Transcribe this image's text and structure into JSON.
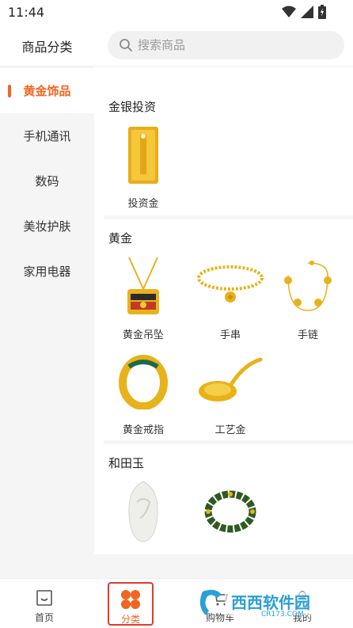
{
  "status_bar": {
    "time": "11:44"
  },
  "header": {
    "title": "商品分类",
    "search_placeholder": "搜索商品"
  },
  "sidebar": {
    "items": [
      {
        "label": "黄金饰品",
        "active": true
      },
      {
        "label": "手机通讯",
        "active": false
      },
      {
        "label": "数码",
        "active": false
      },
      {
        "label": "美妆护肤",
        "active": false
      },
      {
        "label": "家用电器",
        "active": false
      }
    ]
  },
  "content": {
    "sections": [
      {
        "title": "金银投资",
        "products": [
          {
            "label": "投资金"
          }
        ]
      },
      {
        "title": "黄金",
        "products": [
          {
            "label": "黄金吊坠"
          },
          {
            "label": "手串"
          },
          {
            "label": "手链"
          },
          {
            "label": "黄金戒指"
          },
          {
            "label": "工艺金"
          }
        ]
      },
      {
        "title": "和田玉",
        "products": [
          {
            "label": ""
          },
          {
            "label": ""
          }
        ]
      }
    ]
  },
  "tabbar": {
    "tabs": [
      {
        "label": "首页",
        "active": false
      },
      {
        "label": "分类",
        "active": true
      },
      {
        "label": "购物车",
        "active": false
      },
      {
        "label": "我的",
        "active": false
      }
    ]
  },
  "watermark": {
    "text": "西西软件园",
    "subtext": "CR173.COM"
  },
  "colors": {
    "accent": "#f26522",
    "gold": "#e8b21a",
    "active_border": "#e03b2c"
  }
}
